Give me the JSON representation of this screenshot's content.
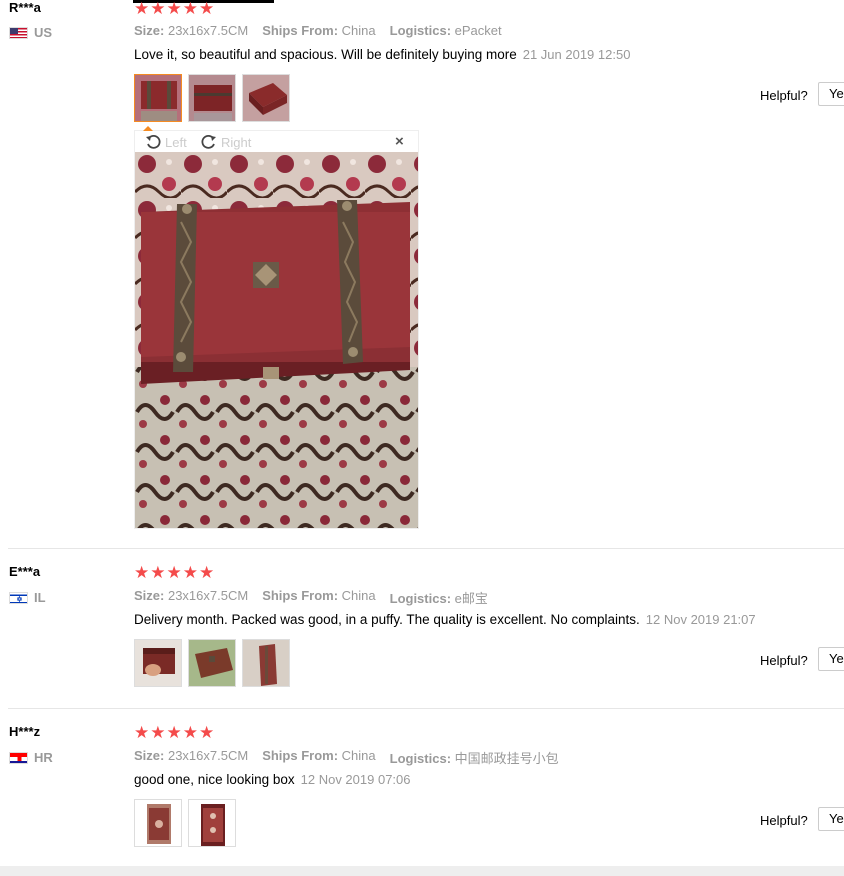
{
  "colors": {
    "star": "#f44b4b",
    "active_thumb": "#f58b22",
    "muted": "#999999"
  },
  "reviews": [
    {
      "buyer": "R***a",
      "country": "US",
      "flag": "us-flag-icon",
      "stars": 5,
      "size_label": "Size:",
      "size_value": "23x16x7.5CM",
      "ships_label": "Ships From:",
      "ships_value": "China",
      "logistics_label": "Logistics:",
      "logistics_value": "ePacket",
      "text": "Love it, so beautiful and spacious. Will be definitely buying more",
      "time": "21 Jun 2019 12:50",
      "helpful": "Helpful?",
      "yes": "Yes"
    },
    {
      "buyer": "E***a",
      "country": "IL",
      "flag": "il-flag-icon",
      "stars": 5,
      "size_label": "Size:",
      "size_value": "23x16x7.5CM",
      "ships_label": "Ships From:",
      "ships_value": "China",
      "logistics_label": "Logistics:",
      "logistics_value": "e邮宝",
      "text": "Delivery month. Packed was good, in a puffy. The quality is excellent. No complaints.",
      "time": "12 Nov 2019 21:07",
      "helpful": "Helpful?",
      "yes": "Yes"
    },
    {
      "buyer": "H***z",
      "country": "HR",
      "flag": "hr-flag-icon",
      "stars": 5,
      "size_label": "Size:",
      "size_value": "23x16x7.5CM",
      "ships_label": "Ships From:",
      "ships_value": "China",
      "logistics_label": "Logistics:",
      "logistics_value": "中国邮政挂号小包",
      "text": "good one, nice looking box",
      "time": "12 Nov 2019 07:06",
      "helpful": "Helpful?",
      "yes": "Yes"
    }
  ],
  "viewer": {
    "left_label": "Left",
    "right_label": "Right",
    "close": "×"
  }
}
